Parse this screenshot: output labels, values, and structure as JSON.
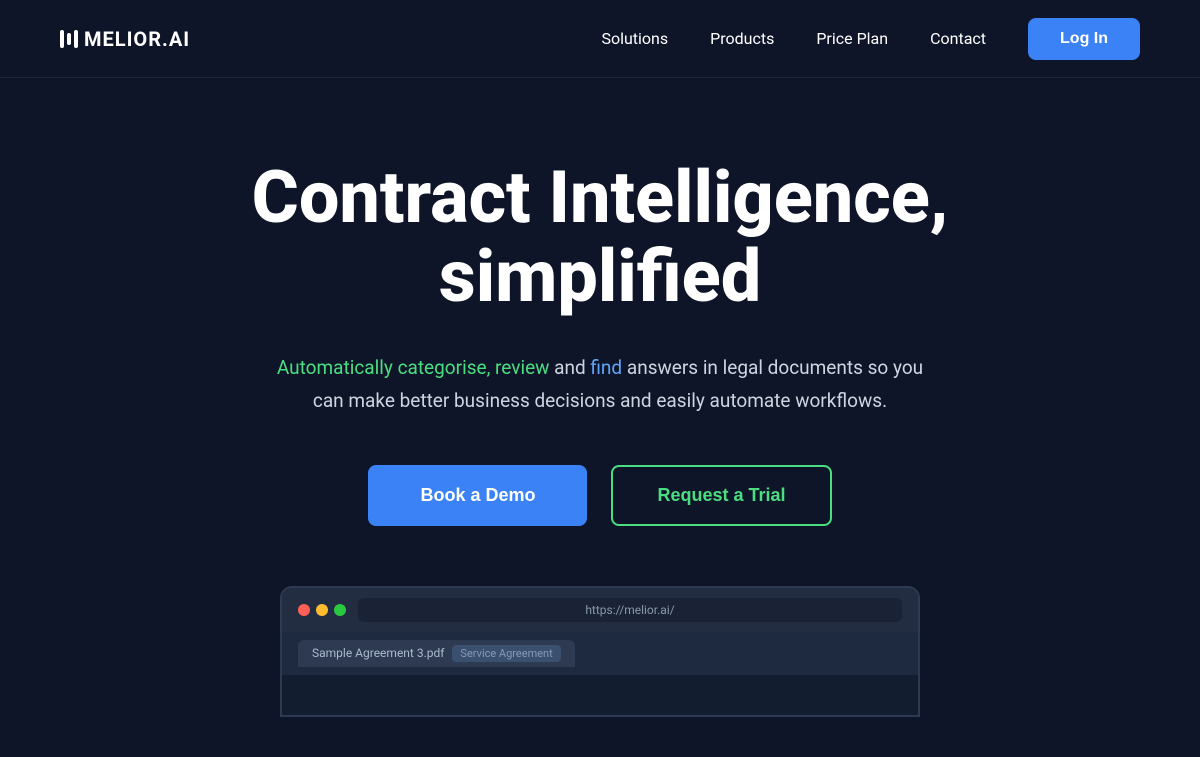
{
  "navbar": {
    "logo_text": "MELIOR.AI",
    "links": [
      {
        "label": "Solutions",
        "id": "solutions"
      },
      {
        "label": "Products",
        "id": "products"
      },
      {
        "label": "Price Plan",
        "id": "price-plan"
      },
      {
        "label": "Contact",
        "id": "contact"
      }
    ],
    "login_label": "Log In"
  },
  "hero": {
    "title": "Contract Intelligence, simplified",
    "subtitle_green": "Automatically categorise, review",
    "subtitle_connector": " and ",
    "subtitle_blue": "find",
    "subtitle_rest": " answers in legal documents so you can make better business decisions and easily automate workflows.",
    "btn_primary": "Book a Demo",
    "btn_outline": "Request a Trial"
  },
  "browser": {
    "url": "https://melior.ai/",
    "tab_label": "Sample Agreement 3.pdf",
    "tag_label": "Service Agreement"
  },
  "colors": {
    "bg": "#0e1529",
    "accent_blue": "#3b82f6",
    "accent_green": "#4ade80",
    "text_white": "#ffffff",
    "text_muted": "#cdd5e0"
  }
}
